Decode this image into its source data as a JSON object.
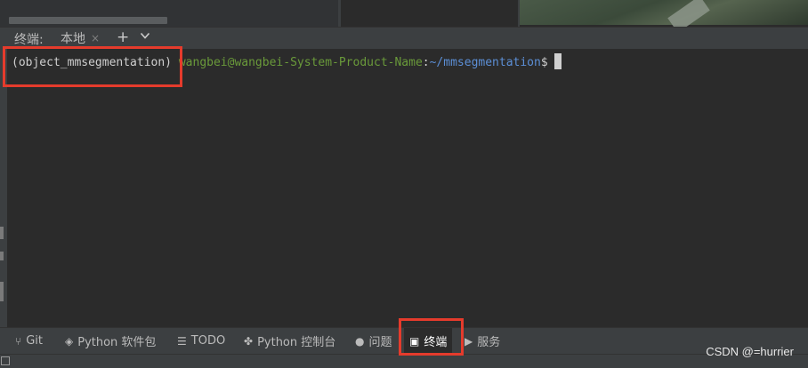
{
  "terminal": {
    "title": "终端:",
    "tabs": [
      {
        "label": "本地",
        "close_glyph": "×"
      }
    ],
    "add_glyph": "+",
    "dropdown_glyph": "⌄"
  },
  "prompt": {
    "env": "(object_mmsegmentation)",
    "user_host": "wangbei@wangbei-System-Product-Name",
    "separator": ":",
    "path": "~/mmsegmentation",
    "symbol": "$"
  },
  "toolbar": {
    "items": [
      {
        "label": "Git",
        "icon": "git-branch-icon",
        "glyph": "⑂"
      },
      {
        "label": "Python 软件包",
        "icon": "packages-icon",
        "glyph": "◈"
      },
      {
        "label": "TODO",
        "icon": "todo-list-icon",
        "glyph": "☰"
      },
      {
        "label": "Python 控制台",
        "icon": "python-console-icon",
        "glyph": "✤"
      },
      {
        "label": "问题",
        "icon": "problems-icon",
        "glyph": "●"
      },
      {
        "label": "终端",
        "icon": "terminal-icon",
        "glyph": "▣"
      },
      {
        "label": "服务",
        "icon": "services-icon",
        "glyph": "▶"
      }
    ],
    "active": "终端"
  },
  "watermark": "CSDN @=hurrier",
  "colors": {
    "annotation": "#e53b2c",
    "user_host": "#6a9a3a",
    "path": "#5c8fd6",
    "background": "#2b2b2b",
    "panel": "#3c3f41"
  }
}
